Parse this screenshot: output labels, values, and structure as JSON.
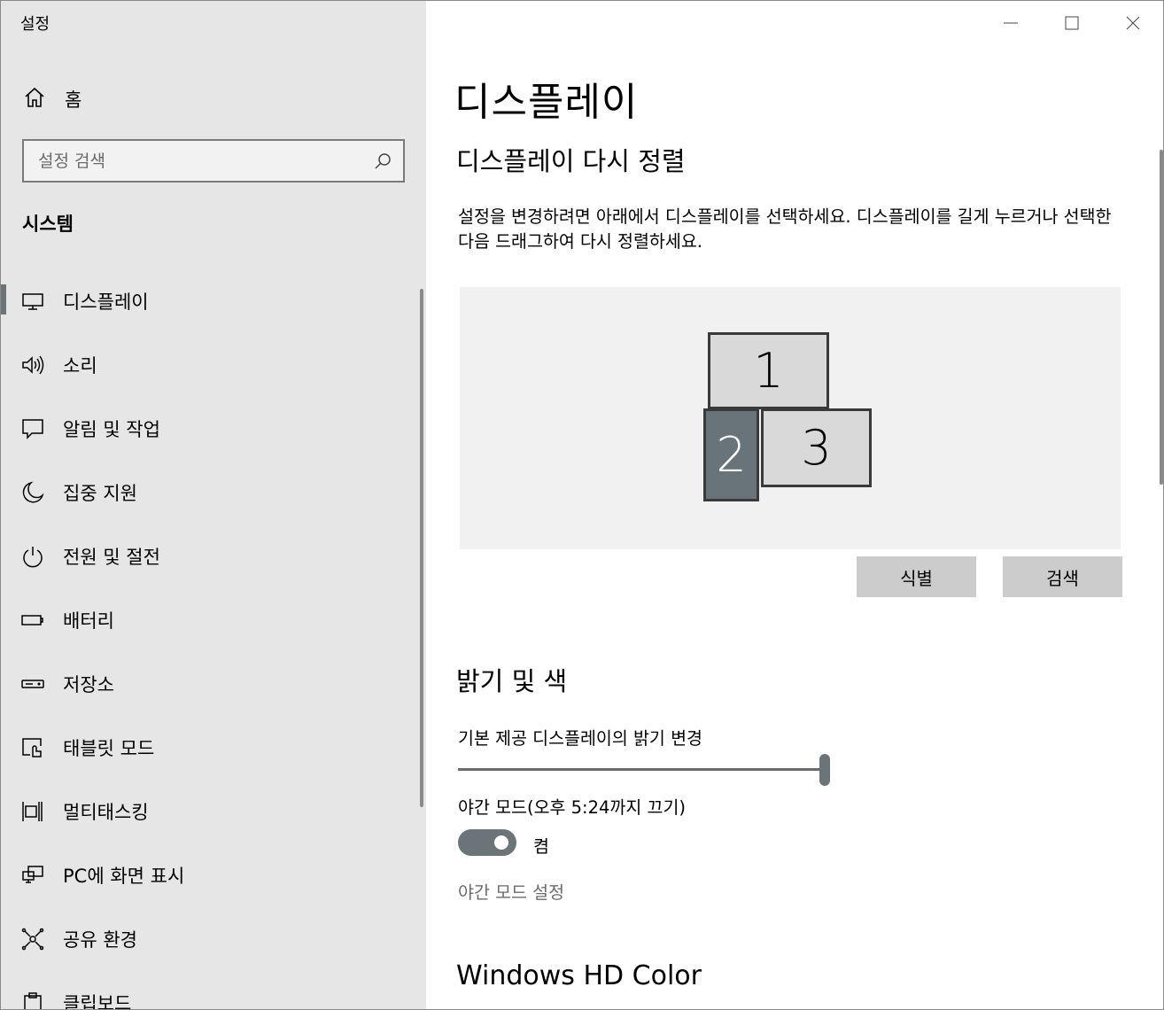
{
  "window": {
    "title": "설정"
  },
  "nav": {
    "home_label": "홈",
    "search_placeholder": "설정 검색",
    "section_label": "시스템",
    "items": [
      {
        "label": "디스플레이",
        "icon": "monitor-icon",
        "selected": true
      },
      {
        "label": "소리",
        "icon": "speaker-icon"
      },
      {
        "label": "알림 및 작업",
        "icon": "notification-icon"
      },
      {
        "label": "집중 지원",
        "icon": "moon-icon"
      },
      {
        "label": "전원 및 절전",
        "icon": "power-icon"
      },
      {
        "label": "배터리",
        "icon": "battery-icon"
      },
      {
        "label": "저장소",
        "icon": "storage-icon"
      },
      {
        "label": "태블릿 모드",
        "icon": "tablet-mode-icon"
      },
      {
        "label": "멀티태스킹",
        "icon": "multitasking-icon"
      },
      {
        "label": "PC에 화면 표시",
        "icon": "project-icon"
      },
      {
        "label": "공유 환경",
        "icon": "shared-experiences-icon"
      },
      {
        "label": "클립보드",
        "icon": "clipboard-icon"
      }
    ]
  },
  "main": {
    "title": "디스플레이",
    "rearrange": {
      "heading": "디스플레이 다시 정렬",
      "description": "설정을 변경하려면 아래에서 디스플레이를 선택하세요. 디스플레이를 길게 누르거나 선택한 다음 드래그하여 다시 정렬하세요.",
      "monitors": [
        "1",
        "2",
        "3"
      ],
      "selected_monitor": "2",
      "identify_label": "식별",
      "detect_label": "검색"
    },
    "brightness": {
      "heading": "밝기 및 색",
      "slider_label": "기본 제공 디스플레이의 밝기 변경",
      "value_percent": 100,
      "night_light_label": "야간 모드(오후 5:24까지 끄기)",
      "night_light_state": "켬",
      "night_light_on": true,
      "night_light_settings_link": "야간 모드 설정"
    },
    "hd_color": {
      "heading": "Windows HD Color"
    }
  },
  "colors": {
    "nav_bg": "#e6e6e6",
    "accent": "#68747a",
    "monitor_fill": "#d9d9d9",
    "button_bg": "#cccccc"
  }
}
